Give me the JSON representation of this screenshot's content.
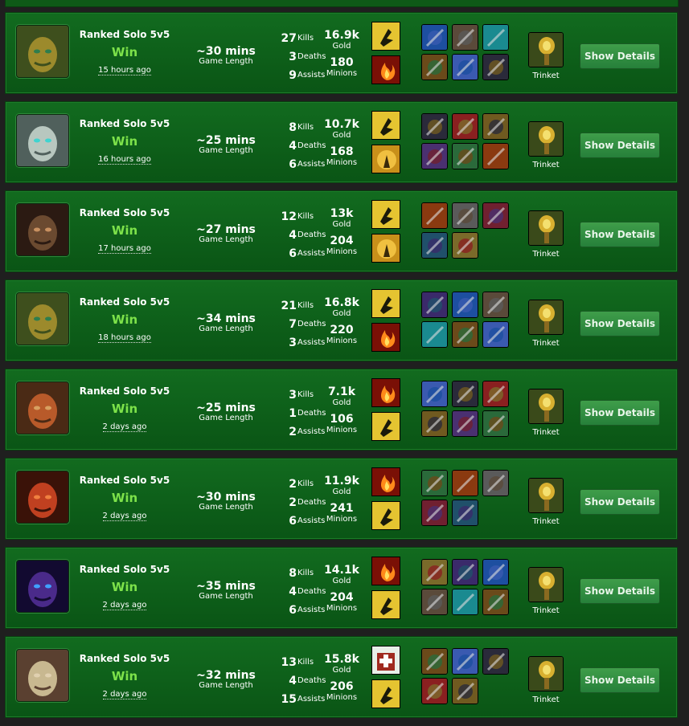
{
  "labels": {
    "kills": "Kills",
    "deaths": "Deaths",
    "assists": "Assists",
    "gold": "Gold",
    "minions": "Minions",
    "game_length": "Game Length",
    "trinket": "Trinket",
    "show_details": "Show Details"
  },
  "matches": [
    {
      "queue": "Ranked Solo 5v5",
      "result": "Win",
      "ago": "15 hours ago",
      "length": "~30 mins",
      "kills": "27",
      "deaths": "3",
      "assists": "9",
      "gold": "16.9k",
      "minions": "180"
    },
    {
      "queue": "Ranked Solo 5v5",
      "result": "Win",
      "ago": "16 hours ago",
      "length": "~25 mins",
      "kills": "8",
      "deaths": "4",
      "assists": "6",
      "gold": "10.7k",
      "minions": "168"
    },
    {
      "queue": "Ranked Solo 5v5",
      "result": "Win",
      "ago": "17 hours ago",
      "length": "~27 mins",
      "kills": "12",
      "deaths": "4",
      "assists": "6",
      "gold": "13k",
      "minions": "204"
    },
    {
      "queue": "Ranked Solo 5v5",
      "result": "Win",
      "ago": "18 hours ago",
      "length": "~34 mins",
      "kills": "21",
      "deaths": "7",
      "assists": "3",
      "gold": "16.8k",
      "minions": "220"
    },
    {
      "queue": "Ranked Solo 5v5",
      "result": "Win",
      "ago": "2 days ago",
      "length": "~25 mins",
      "kills": "3",
      "deaths": "1",
      "assists": "2",
      "gold": "7.1k",
      "minions": "106"
    },
    {
      "queue": "Ranked Solo 5v5",
      "result": "Win",
      "ago": "2 days ago",
      "length": "~30 mins",
      "kills": "2",
      "deaths": "2",
      "assists": "6",
      "gold": "11.9k",
      "minions": "241"
    },
    {
      "queue": "Ranked Solo 5v5",
      "result": "Win",
      "ago": "2 days ago",
      "length": "~35 mins",
      "kills": "8",
      "deaths": "4",
      "assists": "6",
      "gold": "14.1k",
      "minions": "204"
    },
    {
      "queue": "Ranked Solo 5v5",
      "result": "Win",
      "ago": "2 days ago",
      "length": "~32 mins",
      "kills": "13",
      "deaths": "4",
      "assists": "15",
      "gold": "15.8k",
      "minions": "206"
    }
  ],
  "colors": {
    "win": "#7de24a",
    "panel": "#0f6119",
    "button": "#2f8b3f"
  }
}
